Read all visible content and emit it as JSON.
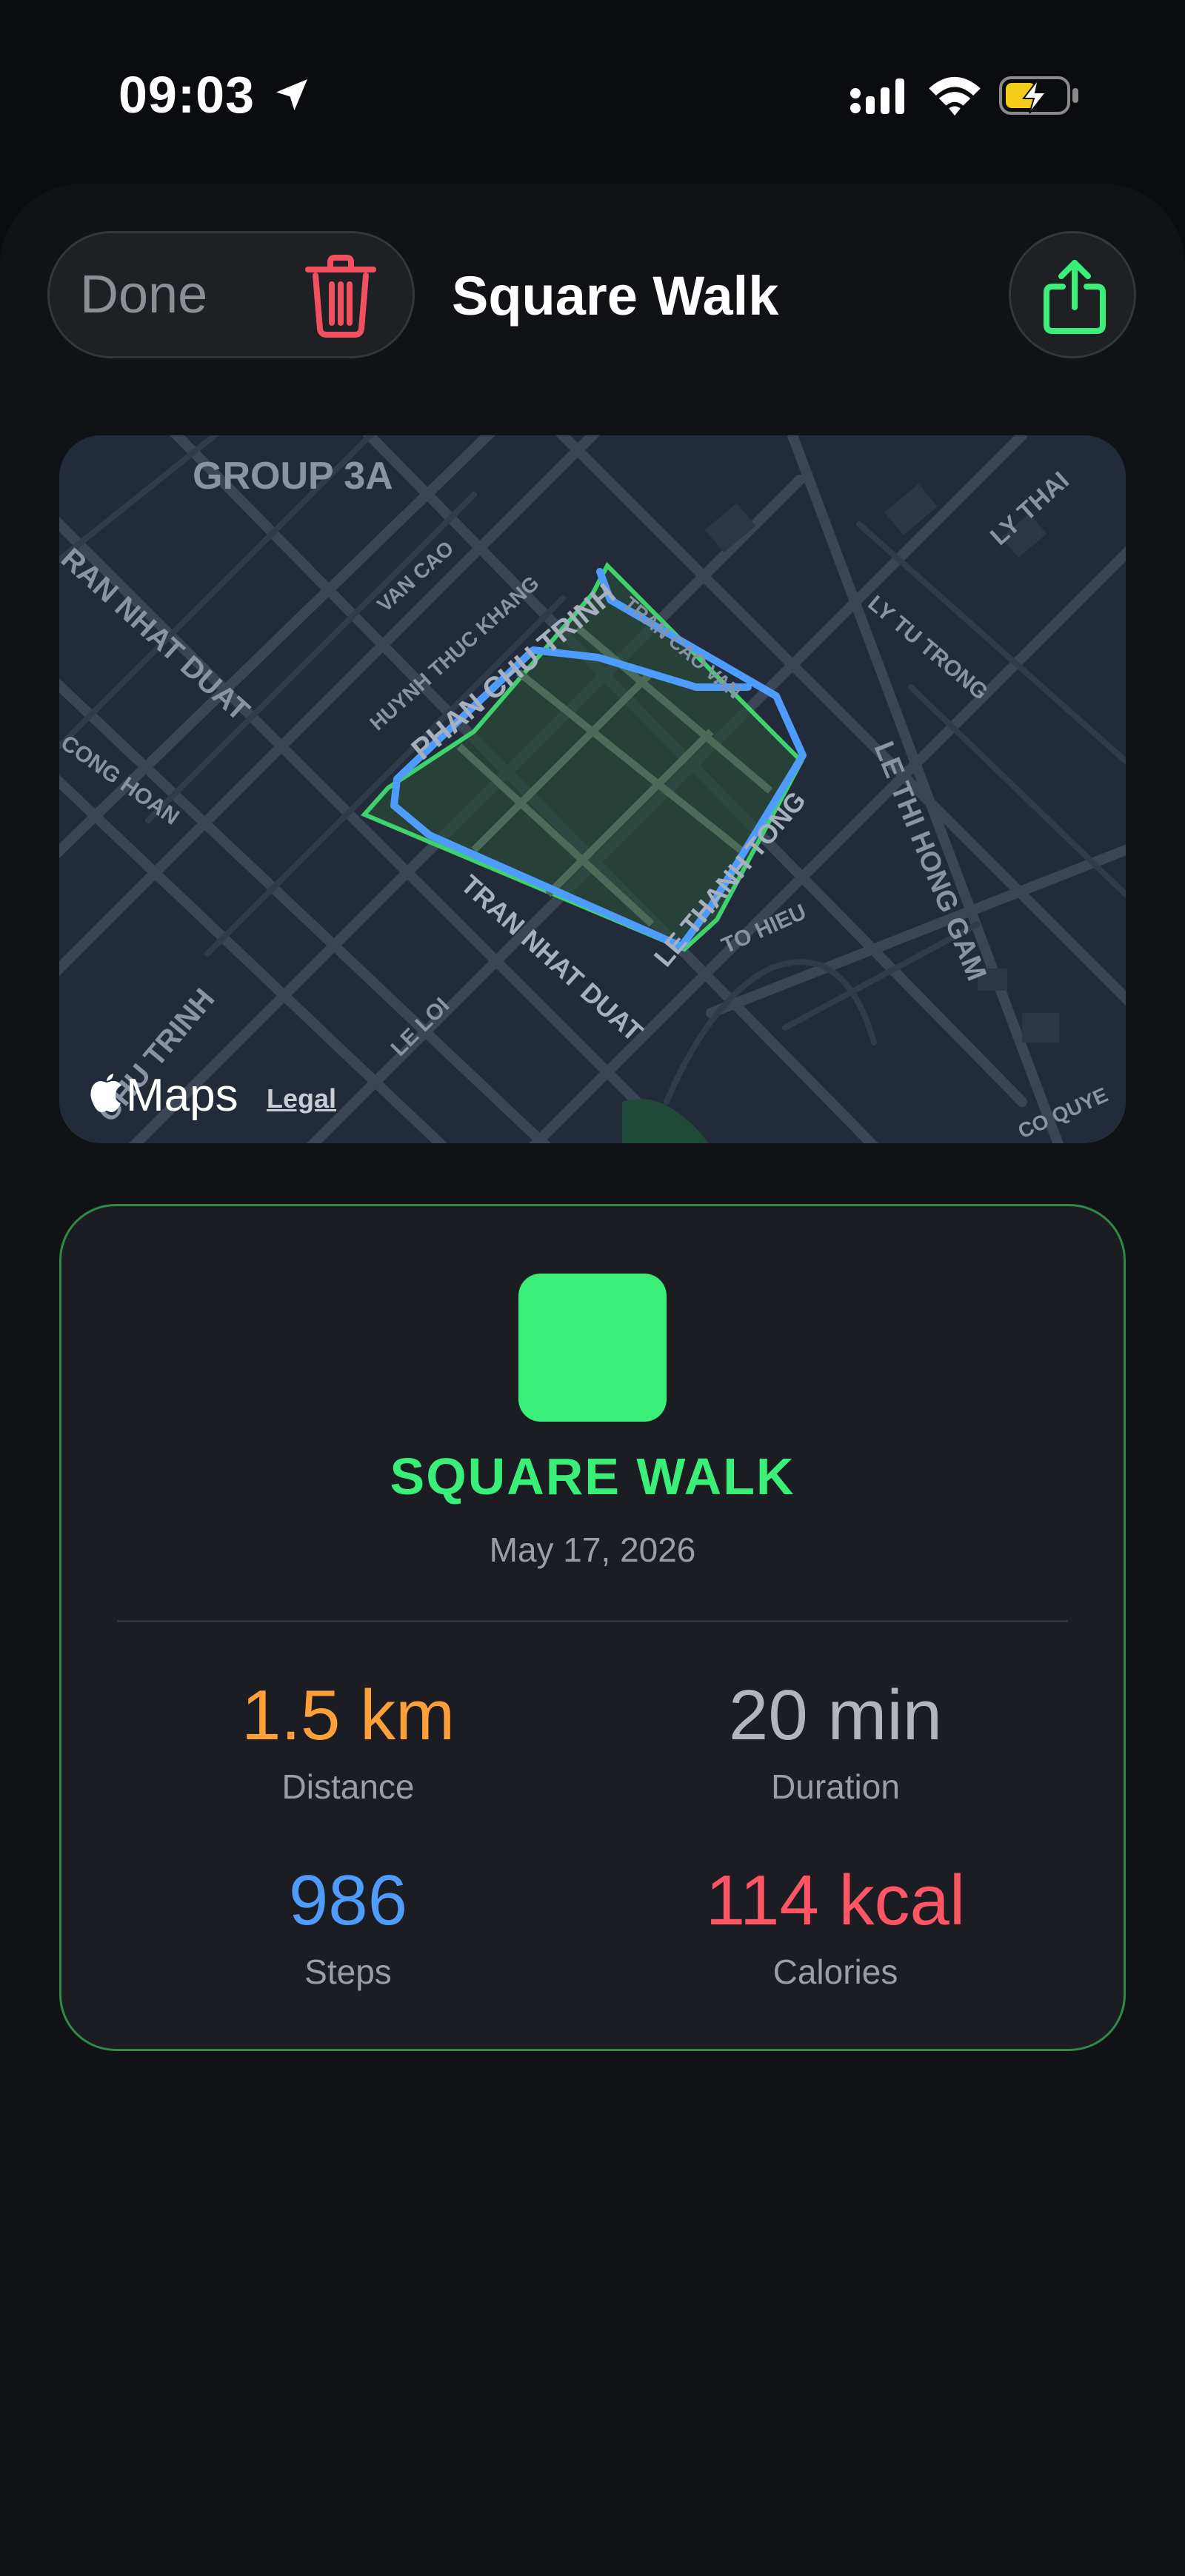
{
  "status_bar": {
    "time": "09:03",
    "icons": [
      "location-arrow-icon",
      "cellular-signal-icon",
      "wifi-icon",
      "battery-charging-icon"
    ]
  },
  "header": {
    "done_label": "Done",
    "title": "Square Walk",
    "icons": [
      "trash-icon",
      "share-icon"
    ]
  },
  "map": {
    "labels": {
      "area": "GROUP 3A",
      "phan_chu_trinh": "PHAN CHU TRINH",
      "tran_nhat_duat": "TRAN NHAT DUAT",
      "le_thanh_tong": "LE THANH TONG",
      "le_thi_hong_gam": "LE THI HONG GAM",
      "tran_cao_van": "TRAN CAO VAN",
      "huynh_thuc_khang": "HUYNH THUC KHANG",
      "van_cao": "VAN CAO",
      "ly_tu_trong": "LY TU TRONG",
      "ly_thai": "LY THAI",
      "to_hieu": "TO HIEU",
      "le_loi": "LE LOI",
      "cong_hoan": "CONG HOAN",
      "chu_trinh": "CHU TRINH",
      "ran_nhat_duat": "RAN NHAT DUAT",
      "co_quye": "CO QUYE"
    },
    "attribution": "Maps",
    "legal": "Legal",
    "colors": {
      "area_outline": "#3fd16b",
      "route": "#4f9cff",
      "background": "#232b3b"
    }
  },
  "summary": {
    "name": "SQUARE WALK",
    "date": "May 17, 2026",
    "badge_color": "#39ef78",
    "stats": {
      "distance": {
        "value": "1.5 km",
        "label": "Distance",
        "color": "#ff9f3a"
      },
      "duration": {
        "value": "20 min",
        "label": "Duration",
        "color": "#b3b5bc"
      },
      "steps": {
        "value": "986",
        "label": "Steps",
        "color": "#4f9cff"
      },
      "calories": {
        "value": "114 kcal",
        "label": "Calories",
        "color": "#ff5564"
      }
    }
  }
}
